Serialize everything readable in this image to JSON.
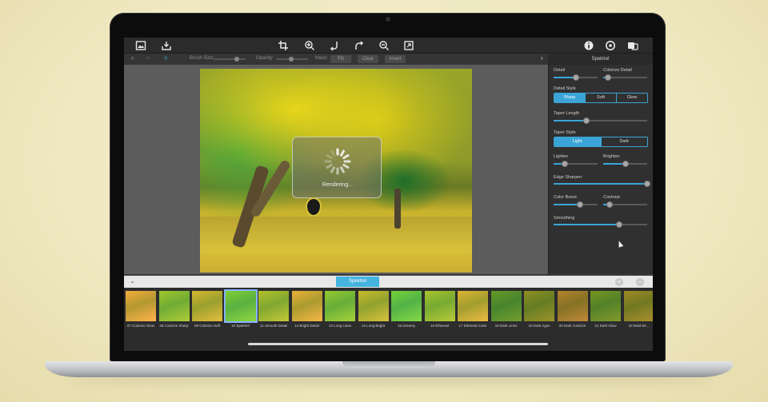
{
  "window": {
    "panel_title": "Spektrel"
  },
  "toolbar": {
    "left_icons": [
      "image-icon",
      "save-icon"
    ],
    "center_icons": [
      "crop-icon",
      "zoom-in-icon",
      "undo-icon",
      "redo-icon",
      "zoom-out-icon",
      "fit-icon"
    ],
    "right_icons": [
      "info-icon",
      "settings-icon",
      "share-icon"
    ]
  },
  "subbar": {
    "brush_size": "Brush Size:",
    "opacity": "Opacity:",
    "mask": "Mask:",
    "fill": "Fill",
    "clear": "Clear",
    "invert": "Invert"
  },
  "canvas": {
    "status": "Rendering..."
  },
  "panel": {
    "detail": {
      "label": "Detail",
      "value": 0.5
    },
    "colorize_detail": {
      "label": "Colorize Detail",
      "value": 0.1
    },
    "detail_style": {
      "label": "Detail Style",
      "options": [
        "Sharp",
        "Soft",
        "Glow"
      ],
      "selected": 0
    },
    "taper_length": {
      "label": "Taper Length",
      "value": 0.35
    },
    "taper_style": {
      "label": "Taper Style",
      "options": [
        "Light",
        "Dark"
      ],
      "selected": 0
    },
    "lighten": {
      "label": "Lighten",
      "value": 0.25
    },
    "brighten": {
      "label": "Brighten",
      "value": 0.5
    },
    "edge_sharpen": {
      "label": "Edge Sharpen",
      "value": 1.0
    },
    "color_boost": {
      "label": "Color Boost",
      "value": 0.6
    },
    "contrast": {
      "label": "Contrast",
      "value": 0.15
    },
    "smoothing": {
      "label": "Smoothing",
      "value": 0.7
    }
  },
  "filmstrip": {
    "title": "Spektrel",
    "thumbs": [
      "07 Colorize Glow",
      "08 Colorize Sharp",
      "09 Colorize Soft",
      "10 Spektrel",
      "11 Smooth Detail",
      "12 Bright Detail",
      "13 Long Lines",
      "14 Long Bright",
      "15 Dreamy",
      "16 Ethereal",
      "17 Ethereal Color",
      "18 Dark Lines",
      "19 Dark Ages",
      "20 Dark Colorize",
      "21 Dark Glow",
      "22 Bold Wi..."
    ],
    "selected_index": 3
  },
  "colors": {
    "accent": "#3aa5d6",
    "panel_bg": "#303031",
    "toolbar_bg": "#2b2b2c"
  }
}
